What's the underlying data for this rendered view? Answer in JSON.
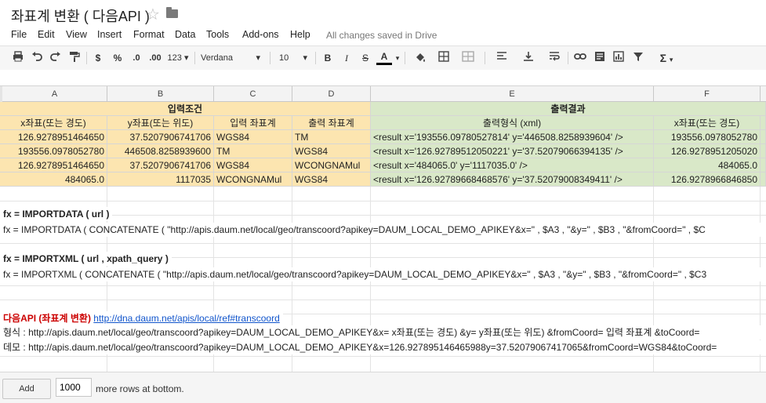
{
  "doc": {
    "title": "좌표계 변환 ( 다음API )",
    "star_icon": "star-icon",
    "folder_icon": "folder-icon"
  },
  "menu": {
    "items": [
      "File",
      "Edit",
      "View",
      "Insert",
      "Format",
      "Data",
      "Tools",
      "Add-ons",
      "Help"
    ],
    "saved_status": "All changes saved in Drive"
  },
  "toolbar": {
    "currency": "$",
    "percent": "%",
    "dec_decrease": ".0",
    "dec_increase": ".00",
    "more_formats": "123",
    "font": "Verdana",
    "font_size": "10",
    "bold": "B",
    "italic": "I",
    "strike": "S",
    "text_color": "A",
    "sum": "Σ"
  },
  "grid": {
    "columns": [
      "A",
      "B",
      "C",
      "D",
      "E",
      "F"
    ],
    "input_header": "입력조건",
    "output_header": "출력결과",
    "subheaders": [
      "x좌표(또는 경도)",
      "y좌표(또는 위도)",
      "입력 좌표계",
      "출력 좌표계",
      "출력형식 (xml)",
      "x좌표(또는 경도)"
    ],
    "rows": [
      [
        "126.9278951464650",
        "37.5207906741706",
        "WGS84",
        "TM",
        "<result x='193556.09780527814' y='446508.8258939604' />",
        "193556.0978052780"
      ],
      [
        "193556.0978052780",
        "446508.8258939600",
        "TM",
        "WGS84",
        "<result x='126.92789512050221' y='37.52079066394135' />",
        "126.9278951205020"
      ],
      [
        "126.9278951464650",
        "37.5207906741706",
        "WGS84",
        "WCONGNAMul",
        "<result x='484065.0' y='1117035.0' />",
        "484065.0"
      ],
      [
        "484065.0",
        "1117035",
        "WCONGNAMul",
        "WGS84",
        "<result x='126.92789668468576' y='37.52079008349411' />",
        "126.9278966846850"
      ]
    ],
    "importdata_label": "fx = IMPORTDATA ( url )",
    "importdata_formula": "fx = IMPORTDATA ( CONCATENATE ( \"http://apis.daum.net/local/geo/transcoord?apikey=DAUM_LOCAL_DEMO_APIKEY&x=\" , $A3 , \"&y=\" , $B3 , \"&fromCoord=\" , $C",
    "importxml_label": "fx = IMPORTXML ( url , xpath_query )",
    "importxml_formula": "fx = IMPORTXML ( CONCATENATE ( \"http://apis.daum.net/local/geo/transcoord?apikey=DAUM_LOCAL_DEMO_APIKEY&x=\" , $A3 , \"&y=\" , $B3 , \"&fromCoord=\" , $C3",
    "daum_label": "다음API (좌표계 변환)",
    "daum_link": "http://dna.daum.net/apis/local/ref#transcoord",
    "format_line": "형식 : http://apis.daum.net/local/geo/transcoord?apikey=DAUM_LOCAL_DEMO_APIKEY&x= x좌표(또는 경도) &y= y좌표(또는 위도) &fromCoord= 입력 좌표계 &toCoord=",
    "demo_line": "데모 : http://apis.daum.net/local/geo/transcoord?apikey=DAUM_LOCAL_DEMO_APIKEY&x=126.927895146465988y=37.52079067417065&fromCoord=WGS84&toCoord="
  },
  "footer": {
    "add_label": "Add",
    "rows_value": "1000",
    "rows_suffix": "more rows at bottom."
  },
  "colors": {
    "input_fill": "#fce5b0",
    "output_fill": "#d9e8c8",
    "accent_red": "#cc0000",
    "link": "#1155cc"
  }
}
